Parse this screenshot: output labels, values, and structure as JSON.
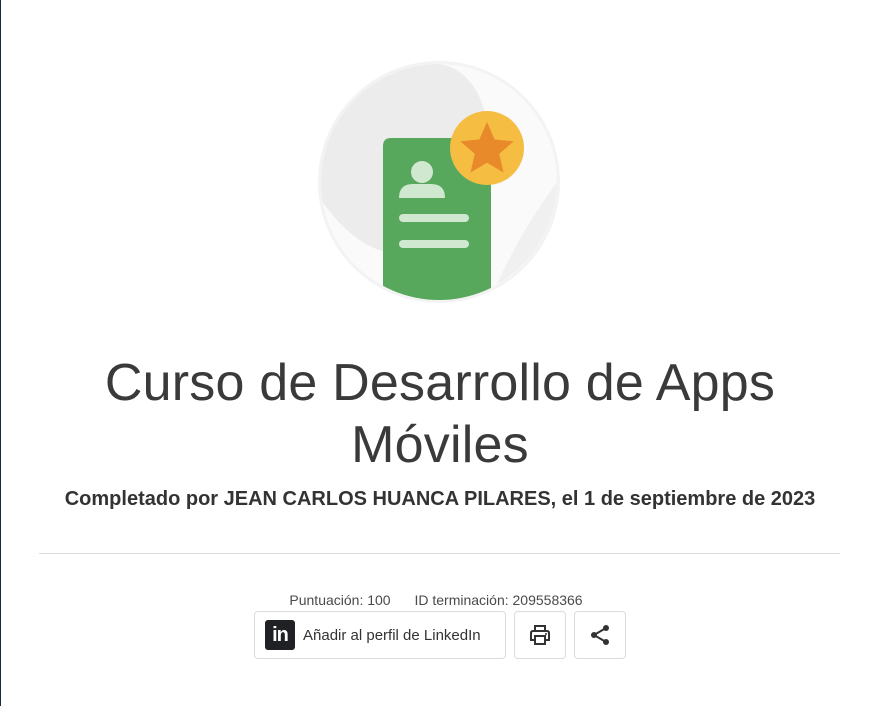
{
  "course": {
    "title_line1": "Curso de Desarrollo de Apps",
    "title_line2": "Móviles",
    "completed_text": "Completado por JEAN CARLOS HUANCA PILARES, el 1 de septiembre de 2023"
  },
  "meta": {
    "score": "Puntuación: 100",
    "completion_id": "ID terminación: 209558366"
  },
  "actions": {
    "linkedin_label": "Añadir al perfil de LinkedIn",
    "linkedin_logo_text": "in",
    "print_icon": "print-icon",
    "share_icon": "share-icon"
  },
  "badge": {
    "icon": "certificate-star-icon",
    "colors": {
      "card": "#57a85d",
      "star_circle": "#f5bd42",
      "star": "#e8892a",
      "circle_bg": "#eeeeee"
    }
  }
}
